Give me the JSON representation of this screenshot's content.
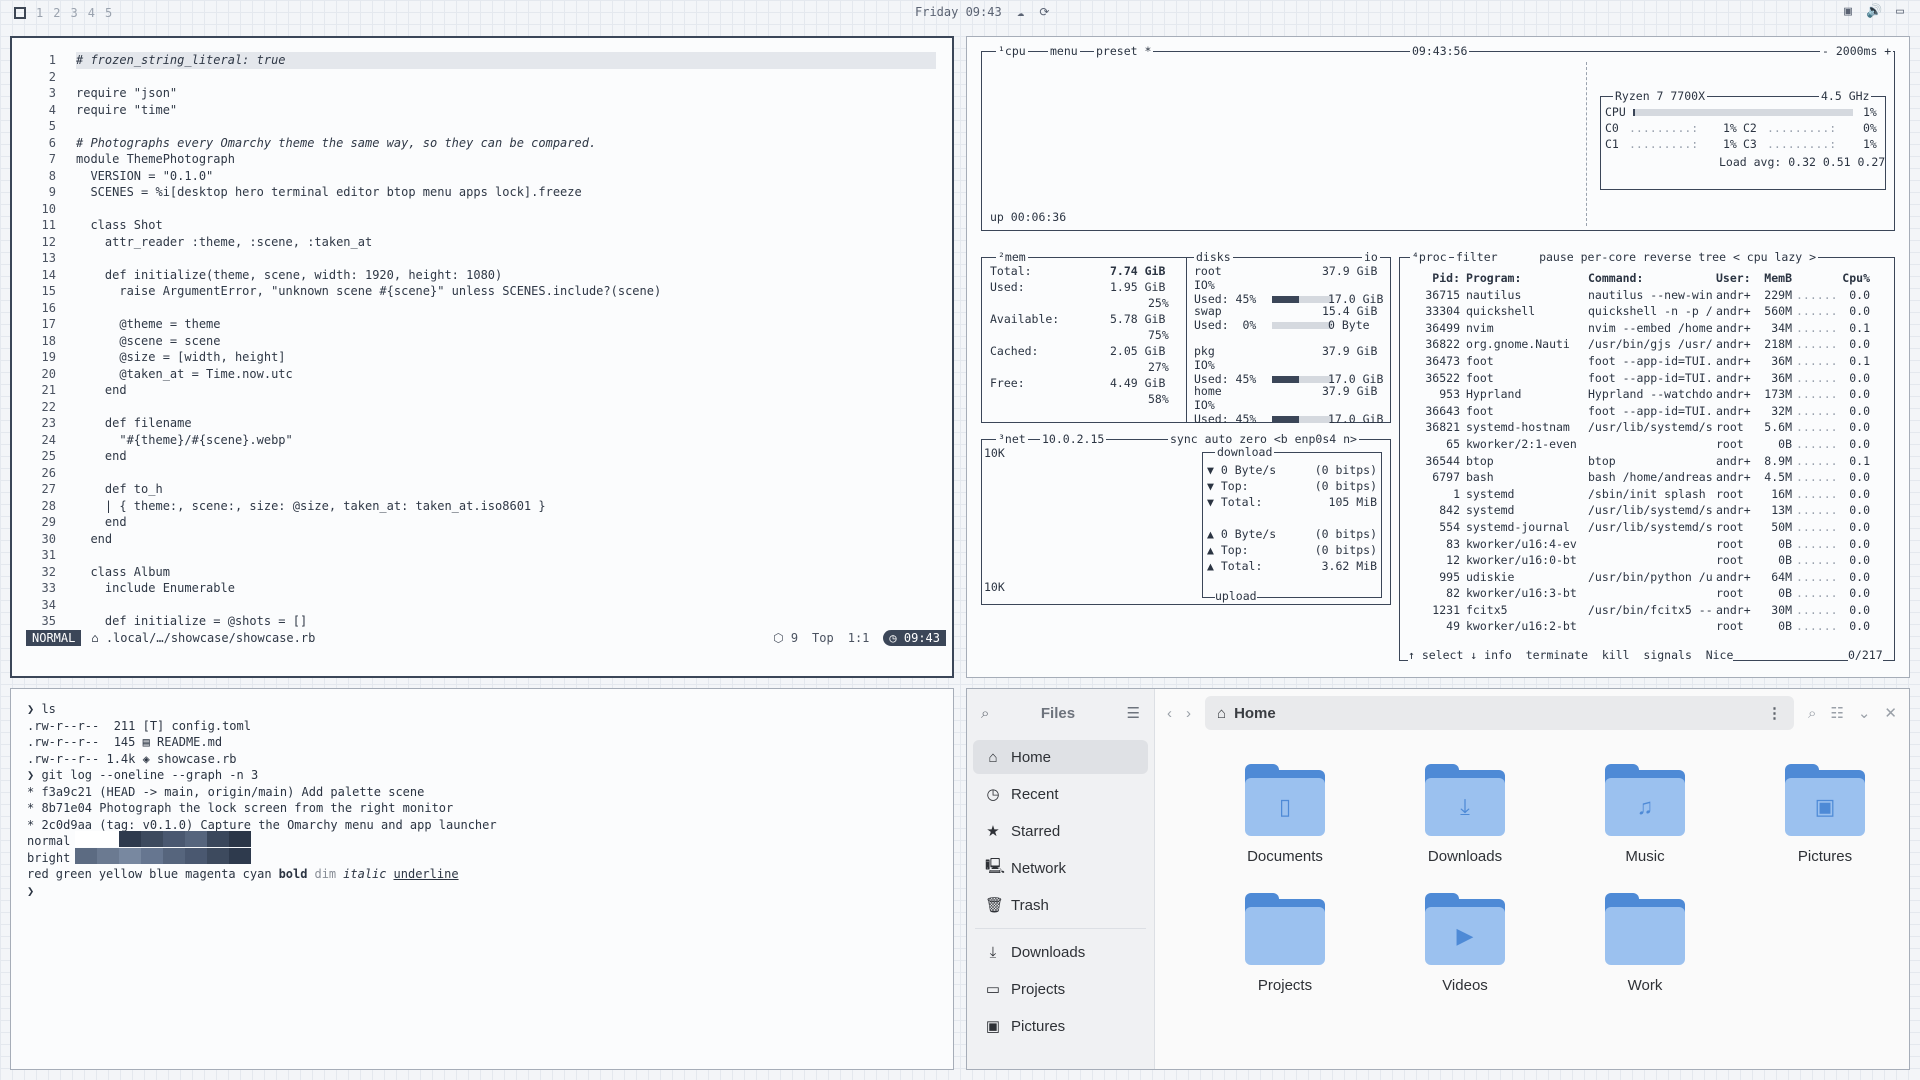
{
  "topbar": {
    "workspaces": [
      "1",
      "2",
      "3",
      "4",
      "5"
    ],
    "clock": "Friday 09:43"
  },
  "editor": {
    "lines": [
      {
        "n": "1",
        "t": "# frozen_string_literal: true",
        "cls": "cm"
      },
      {
        "n": "2",
        "t": ""
      },
      {
        "n": "3",
        "t": "require \"json\""
      },
      {
        "n": "4",
        "t": "require \"time\""
      },
      {
        "n": "5",
        "t": ""
      },
      {
        "n": "6",
        "t": "# Photographs every Omarchy theme the same way, so they can be compared.",
        "cls": "cm"
      },
      {
        "n": "7",
        "t": "module ThemePhotograph"
      },
      {
        "n": "8",
        "t": "  VERSION = \"0.1.0\""
      },
      {
        "n": "9",
        "t": "  SCENES = %i[desktop hero terminal editor btop menu apps lock].freeze"
      },
      {
        "n": "10",
        "t": ""
      },
      {
        "n": "11",
        "t": "  class Shot"
      },
      {
        "n": "12",
        "t": "    attr_reader :theme, :scene, :taken_at"
      },
      {
        "n": "13",
        "t": ""
      },
      {
        "n": "14",
        "t": "    def initialize(theme, scene, width: 1920, height: 1080)"
      },
      {
        "n": "15",
        "t": "      raise ArgumentError, \"unknown scene #{scene}\" unless SCENES.include?(scene)"
      },
      {
        "n": "16",
        "t": ""
      },
      {
        "n": "17",
        "t": "      @theme = theme"
      },
      {
        "n": "18",
        "t": "      @scene = scene"
      },
      {
        "n": "19",
        "t": "      @size = [width, height]"
      },
      {
        "n": "20",
        "t": "      @taken_at = Time.now.utc"
      },
      {
        "n": "21",
        "t": "    end"
      },
      {
        "n": "22",
        "t": ""
      },
      {
        "n": "23",
        "t": "    def filename"
      },
      {
        "n": "24",
        "t": "      \"#{theme}/#{scene}.webp\""
      },
      {
        "n": "25",
        "t": "    end"
      },
      {
        "n": "26",
        "t": ""
      },
      {
        "n": "27",
        "t": "    def to_h"
      },
      {
        "n": "28",
        "t": "    | { theme:, scene:, size: @size, taken_at: taken_at.iso8601 }"
      },
      {
        "n": "29",
        "t": "    end"
      },
      {
        "n": "30",
        "t": "  end"
      },
      {
        "n": "31",
        "t": ""
      },
      {
        "n": "32",
        "t": "  class Album"
      },
      {
        "n": "33",
        "t": "    include Enumerable"
      },
      {
        "n": "34",
        "t": ""
      },
      {
        "n": "35",
        "t": "    def initialize = @shots = []"
      }
    ],
    "status": {
      "mode": "NORMAL",
      "path": ".local/…/showcase/showcase.rb",
      "diag": "9",
      "pos_word": "Top",
      "pos": "1:1",
      "time": "09:43"
    }
  },
  "btop": {
    "cpu": {
      "title": "¹cpu",
      "menu": "menu",
      "preset": "preset *",
      "clock": "09:43:56",
      "interval": "- 2000ms +",
      "uptime": "up 00:06:36",
      "model": "Ryzen 7 7700X",
      "freq": "4.5 GHz",
      "total_label": "CPU",
      "total_pct": "1%",
      "cores": [
        {
          "name": "C0",
          "pct": "1%"
        },
        {
          "name": "C2",
          "pct": "0%"
        },
        {
          "name": "C1",
          "pct": "1%"
        },
        {
          "name": "C3",
          "pct": "1%"
        }
      ],
      "load": "Load avg: 0.32 0.51 0.27"
    },
    "mem": {
      "title": "²mem",
      "total_label": "Total:",
      "total": "7.74 GiB",
      "used_label": "Used:",
      "used": "1.95 GiB",
      "used_pct": "25%",
      "avail_label": "Available:",
      "avail": "5.78 GiB",
      "avail_pct": "75%",
      "cached_label": "Cached:",
      "cached": "2.05 GiB",
      "cached_pct": "27%",
      "free_label": "Free:",
      "free": "4.49 GiB",
      "free_pct": "58%"
    },
    "disks": {
      "title": "disks",
      "io": "io",
      "items": [
        {
          "name": "root",
          "size": "37.9 GiB",
          "io": "IO%",
          "used_label": "Used: 45%",
          "used": "17.0 GiB",
          "frac": 0.45
        },
        {
          "name": "swap",
          "size": "15.4 GiB",
          "io": "",
          "used_label": "Used:  0%",
          "used": "0 Byte",
          "frac": 0.0
        },
        {
          "name": "pkg",
          "size": "37.9 GiB",
          "io": "IO%",
          "used_label": "Used: 45%",
          "used": "17.0 GiB",
          "frac": 0.45
        },
        {
          "name": "home",
          "size": "37.9 GiB",
          "io": "IO%",
          "used_label": "Used: 45%",
          "used": "17.0 GiB",
          "frac": 0.45
        }
      ]
    },
    "net": {
      "title": "³net",
      "ip": "10.0.2.15",
      "opts": "sync auto zero <b enp0s4 n>",
      "scale_top": "10K",
      "scale_bottom": "10K",
      "download_label": "download",
      "upload_label": "upload",
      "down": [
        {
          "k": "▼ 0 Byte/s",
          "v": "(0 bitps)"
        },
        {
          "k": "▼ Top:",
          "v": "(0 bitps)"
        },
        {
          "k": "▼ Total:",
          "v": "105 MiB"
        }
      ],
      "up": [
        {
          "k": "▲ 0 Byte/s",
          "v": "(0 bitps)"
        },
        {
          "k": "▲ Top:",
          "v": "(0 bitps)"
        },
        {
          "k": "▲ Total:",
          "v": "3.62 MiB"
        }
      ]
    },
    "proc": {
      "title": "⁴proc",
      "opts": "filter      pause per-core reverse tree < cpu lazy >",
      "headers": [
        "Pid:",
        "Program:",
        "Command:",
        "User:",
        "MemB",
        "",
        "Cpu%"
      ],
      "rows": [
        [
          "36715",
          "nautilus",
          "nautilus --new-win",
          "andr+",
          "229M",
          "0.0"
        ],
        [
          "33304",
          "quickshell",
          "quickshell -n -p /",
          "andr+",
          "560M",
          "0.0"
        ],
        [
          "36499",
          "nvim",
          "nvim --embed /home",
          "andr+",
          "34M",
          "0.1"
        ],
        [
          "36822",
          "org.gnome.Nauti",
          "/usr/bin/gjs /usr/",
          "andr+",
          "218M",
          "0.0"
        ],
        [
          "36473",
          "foot",
          "foot --app-id=TUI.",
          "andr+",
          "36M",
          "0.1"
        ],
        [
          "36522",
          "foot",
          "foot --app-id=TUI.",
          "andr+",
          "36M",
          "0.0"
        ],
        [
          "953",
          "Hyprland",
          "Hyprland --watchdo",
          "andr+",
          "173M",
          "0.0"
        ],
        [
          "36643",
          "foot",
          "foot --app-id=TUI.",
          "andr+",
          "32M",
          "0.0"
        ],
        [
          "36821",
          "systemd-hostnam",
          "/usr/lib/systemd/s",
          "root",
          "5.6M",
          "0.0"
        ],
        [
          "65",
          "kworker/2:1-even",
          "",
          "root",
          "0B",
          "0.0"
        ],
        [
          "36544",
          "btop",
          "btop",
          "andr+",
          "8.9M",
          "0.1"
        ],
        [
          "6797",
          "bash",
          "bash /home/andreas",
          "andr+",
          "4.5M",
          "0.0"
        ],
        [
          "1",
          "systemd",
          "/sbin/init splash",
          "root",
          "16M",
          "0.0"
        ],
        [
          "842",
          "systemd",
          "/usr/lib/systemd/s",
          "andr+",
          "13M",
          "0.0"
        ],
        [
          "554",
          "systemd-journal",
          "/usr/lib/systemd/s",
          "root",
          "50M",
          "0.0"
        ],
        [
          "83",
          "kworker/u16:4-ev",
          "",
          "root",
          "0B",
          "0.0"
        ],
        [
          "12",
          "kworker/u16:0-bt",
          "",
          "root",
          "0B",
          "0.0"
        ],
        [
          "995",
          "udiskie",
          "/usr/bin/python /u",
          "andr+",
          "64M",
          "0.0"
        ],
        [
          "82",
          "kworker/u16:3-bt",
          "",
          "root",
          "0B",
          "0.0"
        ],
        [
          "1231",
          "fcitx5",
          "/usr/bin/fcitx5 --",
          "andr+",
          "30M",
          "0.0"
        ],
        [
          "49",
          "kworker/u16:2-bt",
          "",
          "root",
          "0B",
          "0.0"
        ]
      ],
      "footer": "↑ select ↓ info  terminate  kill  signals  Nice",
      "count": "0/217"
    }
  },
  "terminal": {
    "lines": [
      "❯ ls",
      ".rw-r--r--  211 [T] config.toml",
      ".rw-r--r--  145 ▤ README.md",
      ".rw-r--r-- 1.4k ◈ showcase.rb",
      "❯ git log --oneline --graph -n 3",
      "* f3a9c21 (HEAD -> main, origin/main) Add palette scene",
      "* 8b71e04 Photograph the lock screen from the right monitor",
      "* 2c0d9aa (tag: v0.1.0) Capture the Omarchy menu and app launcher"
    ],
    "normal_label": "normal",
    "bright_label": "bright",
    "normal_colors": [
      "#ffffff",
      "#ffffff",
      "#2e3a4d",
      "#3d4a5e",
      "#4a5870",
      "#56657d",
      "#3a475b",
      "#2b3647"
    ],
    "bright_colors": [
      "#5c6b82",
      "#6b7a91",
      "#7888a0",
      "#667690",
      "#56657d",
      "#4a5870",
      "#3d4a5e",
      "#2e3a4d"
    ],
    "styles": [
      "red",
      "green",
      "yellow",
      "blue",
      "magenta",
      "cyan",
      "bold",
      "dim",
      "italic",
      "underline"
    ],
    "prompt": "❯"
  },
  "files": {
    "app_title": "Files",
    "location": "Home",
    "sidebar": [
      {
        "label": "Home",
        "icon": "home-icon",
        "glyph": "⌂"
      },
      {
        "label": "Recent",
        "icon": "clock-icon",
        "glyph": "◷"
      },
      {
        "label": "Starred",
        "icon": "star-icon",
        "glyph": "★"
      },
      {
        "label": "Network",
        "icon": "network-icon",
        "glyph": "🖳"
      },
      {
        "label": "Trash",
        "icon": "trash-icon",
        "glyph": "🗑"
      }
    ],
    "bookmarks": [
      {
        "label": "Downloads",
        "icon": "download-icon",
        "glyph": "⤓"
      },
      {
        "label": "Projects",
        "icon": "folder-icon",
        "glyph": "▭"
      },
      {
        "label": "Pictures",
        "icon": "image-icon",
        "glyph": "▣"
      }
    ],
    "folders": [
      {
        "label": "Documents",
        "glyph": "▯",
        "icon": "document-icon"
      },
      {
        "label": "Downloads",
        "glyph": "⤓",
        "icon": "download-icon"
      },
      {
        "label": "Music",
        "glyph": "♫",
        "icon": "music-icon"
      },
      {
        "label": "Pictures",
        "glyph": "▣",
        "icon": "image-icon"
      },
      {
        "label": "Projects",
        "glyph": "",
        "icon": "folder-icon"
      },
      {
        "label": "Videos",
        "glyph": "▶",
        "icon": "video-icon"
      },
      {
        "label": "Work",
        "glyph": "",
        "icon": "folder-icon"
      }
    ]
  }
}
